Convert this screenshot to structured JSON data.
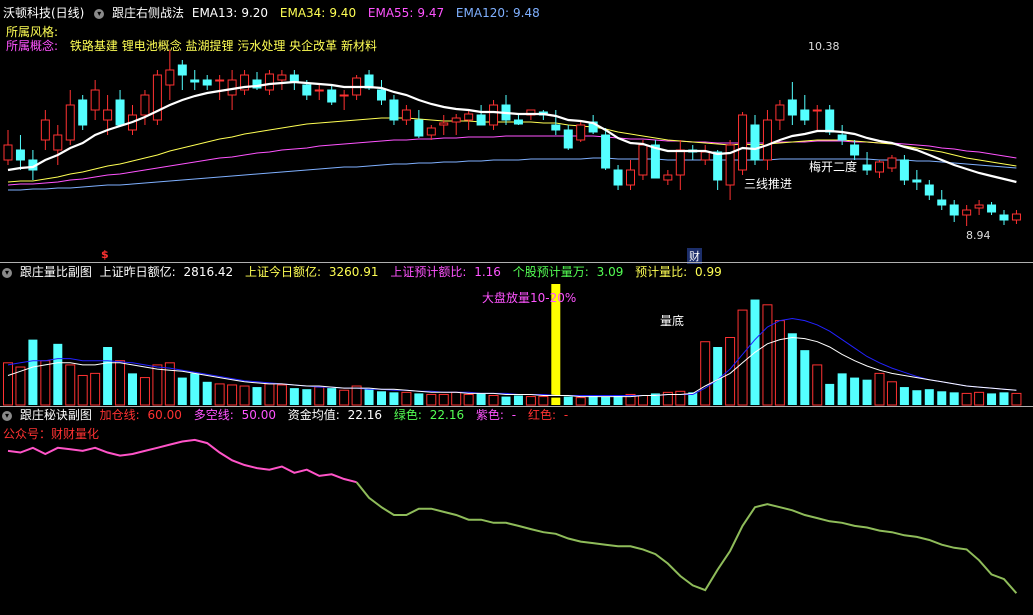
{
  "main_panel": {
    "stock_title": "沃顿科技(日线)",
    "indicator_name": "跟庄右侧战法",
    "ema13": {
      "label": "EMA13:",
      "value": "9.20"
    },
    "ema34": {
      "label": "EMA34:",
      "value": "9.40"
    },
    "ema55": {
      "label": "EMA55:",
      "value": "9.47"
    },
    "ema120": {
      "label": "EMA120:",
      "value": "9.48"
    },
    "style_label": "所属风格:",
    "concept_label": "所属概念:",
    "concepts": "铁路基建 锂电池概念 盐湖提锂 污水处理 央企改革 新材料",
    "high_label": "10.38",
    "low_label": "8.94",
    "annotation_push": "三线推进",
    "annotation_plum": "梅开二度",
    "marker_dollar": "$",
    "marker_cai": "财"
  },
  "volume_panel": {
    "name": "跟庄量比副图",
    "sh_yesterday": {
      "label": "上证昨日额亿:",
      "value": "2816.42"
    },
    "sh_today": {
      "label": "上证今日额亿:",
      "value": "3260.91"
    },
    "sh_forecast_ratio": {
      "label": "上证预计额比:",
      "value": "1.16"
    },
    "stock_forecast_vol": {
      "label": "个股预计量万:",
      "value": "3.09"
    },
    "forecast_ratio": {
      "label": "预计量比:",
      "value": "0.99"
    },
    "annotation_market": "大盘放量10-20%",
    "annotation_bottom": "量底"
  },
  "secret_panel": {
    "name": "跟庄秘诀副图",
    "add_line": {
      "label": "加仓线:",
      "value": "60.00"
    },
    "short_line": {
      "label": "多空线:",
      "value": "50.00"
    },
    "fund_avg": {
      "label": "资金均值:",
      "value": "22.16"
    },
    "green": {
      "label": "绿色:",
      "value": "22.16"
    },
    "purple": {
      "label": "紫色:",
      "value": "-"
    },
    "red": {
      "label": "红色:",
      "value": "-"
    },
    "public_account": "公众号：财财量化"
  },
  "colors": {
    "up": "#ff3232",
    "down": "#54ffff",
    "ema13": "#ffffff",
    "ema34": "#ffff54",
    "ema55": "#ff54ff",
    "ema120": "#7fb0ff",
    "vol_ma1": "#ffffff",
    "vol_ma2": "#2222ff",
    "yellow_bar": "#ffff00",
    "line_pink": "#ff54c8",
    "line_green": "#8fbc5a"
  },
  "chart_data": [
    {
      "type": "candlestick",
      "name": "price",
      "candles": [
        [
          9.6,
          9.9,
          9.55,
          9.75
        ],
        [
          9.7,
          9.85,
          9.5,
          9.6
        ],
        [
          9.6,
          9.7,
          9.4,
          9.5
        ],
        [
          9.8,
          10.1,
          9.7,
          10.0
        ],
        [
          9.7,
          9.95,
          9.55,
          9.85
        ],
        [
          9.8,
          10.3,
          9.75,
          10.15
        ],
        [
          10.2,
          10.25,
          9.9,
          9.95
        ],
        [
          10.1,
          10.4,
          10.0,
          10.3
        ],
        [
          10.0,
          10.25,
          9.85,
          10.1
        ],
        [
          10.2,
          10.3,
          9.95,
          9.95
        ],
        [
          9.9,
          10.15,
          9.85,
          10.05
        ],
        [
          10.05,
          10.3,
          9.95,
          10.25
        ],
        [
          10.0,
          10.5,
          9.95,
          10.45
        ],
        [
          10.35,
          10.7,
          10.2,
          10.5
        ],
        [
          10.55,
          10.6,
          10.3,
          10.45
        ],
        [
          10.4,
          10.5,
          10.3,
          10.38
        ],
        [
          10.4,
          10.45,
          10.3,
          10.35
        ],
        [
          10.4,
          10.45,
          10.2,
          10.4
        ],
        [
          10.25,
          10.5,
          10.1,
          10.4
        ],
        [
          10.3,
          10.5,
          10.25,
          10.45
        ],
        [
          10.4,
          10.48,
          10.3,
          10.32
        ],
        [
          10.3,
          10.5,
          10.25,
          10.46
        ],
        [
          10.4,
          10.5,
          10.3,
          10.45
        ],
        [
          10.45,
          10.5,
          10.3,
          10.38
        ],
        [
          10.35,
          10.4,
          10.2,
          10.25
        ],
        [
          10.3,
          10.35,
          10.2,
          10.3
        ],
        [
          10.3,
          10.35,
          10.15,
          10.18
        ],
        [
          10.25,
          10.3,
          10.1,
          10.25
        ],
        [
          10.25,
          10.45,
          10.2,
          10.42
        ],
        [
          10.45,
          10.5,
          10.3,
          10.32
        ],
        [
          10.3,
          10.4,
          10.15,
          10.2
        ],
        [
          10.2,
          10.25,
          9.95,
          10.0
        ],
        [
          10.0,
          10.15,
          9.95,
          10.1
        ],
        [
          10.0,
          10.1,
          9.82,
          9.84
        ],
        [
          9.85,
          9.95,
          9.8,
          9.92
        ],
        [
          9.95,
          10.05,
          9.85,
          9.97
        ],
        [
          9.98,
          10.06,
          9.85,
          10.02
        ],
        [
          10.0,
          10.1,
          9.9,
          10.06
        ],
        [
          10.05,
          10.15,
          9.95,
          9.95
        ],
        [
          9.95,
          10.2,
          9.9,
          10.15
        ],
        [
          10.15,
          10.25,
          9.95,
          10.0
        ],
        [
          10.0,
          10.05,
          9.95,
          9.96
        ],
        [
          10.05,
          10.1,
          10.0,
          10.1
        ],
        [
          10.08,
          10.1,
          10.0,
          10.05
        ],
        [
          9.95,
          10.1,
          9.85,
          9.9
        ],
        [
          9.9,
          9.95,
          9.7,
          9.72
        ],
        [
          9.8,
          10.0,
          9.78,
          9.95
        ],
        [
          9.98,
          10.05,
          9.86,
          9.88
        ],
        [
          9.85,
          9.92,
          9.5,
          9.52
        ],
        [
          9.5,
          9.55,
          9.3,
          9.35
        ],
        [
          9.35,
          9.6,
          9.3,
          9.5
        ],
        [
          9.45,
          9.8,
          9.4,
          9.75
        ],
        [
          9.75,
          9.8,
          9.42,
          9.42
        ],
        [
          9.4,
          9.5,
          9.35,
          9.45
        ],
        [
          9.45,
          9.8,
          9.3,
          9.7
        ],
        [
          9.7,
          9.75,
          9.6,
          9.68
        ],
        [
          9.6,
          9.75,
          9.55,
          9.68
        ],
        [
          9.68,
          9.7,
          9.3,
          9.4
        ],
        [
          9.35,
          9.8,
          9.2,
          9.75
        ],
        [
          9.5,
          10.08,
          9.45,
          10.05
        ],
        [
          9.95,
          10.05,
          9.55,
          9.6
        ],
        [
          9.6,
          10.1,
          9.5,
          10.0
        ],
        [
          10.0,
          10.2,
          9.9,
          10.15
        ],
        [
          10.2,
          10.38,
          9.95,
          10.05
        ],
        [
          10.1,
          10.25,
          9.95,
          10.0
        ],
        [
          10.1,
          10.15,
          9.9,
          10.1
        ],
        [
          10.1,
          10.15,
          9.85,
          9.88
        ],
        [
          9.85,
          9.95,
          9.75,
          9.8
        ],
        [
          9.75,
          9.8,
          9.6,
          9.65
        ],
        [
          9.55,
          9.68,
          9.45,
          9.5
        ],
        [
          9.48,
          9.6,
          9.42,
          9.58
        ],
        [
          9.52,
          9.65,
          9.48,
          9.62
        ],
        [
          9.6,
          9.65,
          9.35,
          9.4
        ],
        [
          9.4,
          9.5,
          9.3,
          9.38
        ],
        [
          9.35,
          9.4,
          9.2,
          9.25
        ],
        [
          9.2,
          9.3,
          9.1,
          9.15
        ],
        [
          9.15,
          9.2,
          8.98,
          9.05
        ],
        [
          9.05,
          9.15,
          8.94,
          9.1
        ],
        [
          9.12,
          9.2,
          9.05,
          9.15
        ],
        [
          9.15,
          9.18,
          9.05,
          9.08
        ],
        [
          9.05,
          9.1,
          8.95,
          9.0
        ],
        [
          9.0,
          9.1,
          8.96,
          9.06
        ]
      ],
      "ema13": [
        9.5,
        9.52,
        9.53,
        9.6,
        9.65,
        9.72,
        9.77,
        9.85,
        9.9,
        9.94,
        9.98,
        10.03,
        10.09,
        10.15,
        10.2,
        10.24,
        10.27,
        10.29,
        10.31,
        10.33,
        10.34,
        10.36,
        10.37,
        10.38,
        10.37,
        10.36,
        10.35,
        10.33,
        10.33,
        10.33,
        10.32,
        10.28,
        10.25,
        10.2,
        10.16,
        10.13,
        10.11,
        10.1,
        10.08,
        10.08,
        10.07,
        10.06,
        10.06,
        10.06,
        10.04,
        10.0,
        9.99,
        9.97,
        9.9,
        9.82,
        9.77,
        9.76,
        9.72,
        9.69,
        9.69,
        9.69,
        9.69,
        9.66,
        9.67,
        9.72,
        9.71,
        9.75,
        9.8,
        9.84,
        9.86,
        9.89,
        9.89,
        9.88,
        9.86,
        9.82,
        9.79,
        9.77,
        9.73,
        9.7,
        9.65,
        9.6,
        9.55,
        9.51,
        9.47,
        9.44,
        9.41,
        9.38
      ],
      "ema34": [
        9.38,
        9.39,
        9.39,
        9.41,
        9.43,
        9.46,
        9.48,
        9.51,
        9.54,
        9.56,
        9.59,
        9.62,
        9.65,
        9.69,
        9.72,
        9.75,
        9.78,
        9.81,
        9.83,
        9.86,
        9.88,
        9.9,
        9.92,
        9.94,
        9.96,
        9.97,
        9.98,
        9.99,
        10.0,
        10.01,
        10.02,
        10.02,
        10.02,
        10.01,
        10.0,
        9.99,
        9.99,
        9.99,
        9.98,
        9.98,
        9.98,
        9.98,
        9.98,
        9.97,
        9.97,
        9.95,
        9.94,
        9.93,
        9.91,
        9.88,
        9.86,
        9.84,
        9.82,
        9.8,
        9.79,
        9.78,
        9.77,
        9.76,
        9.75,
        9.76,
        9.75,
        9.76,
        9.77,
        9.78,
        9.79,
        9.8,
        9.8,
        9.8,
        9.79,
        9.78,
        9.77,
        9.76,
        9.74,
        9.72,
        9.7,
        9.68,
        9.65,
        9.62,
        9.6,
        9.58,
        9.56,
        9.54
      ],
      "ema55": [
        9.35,
        9.36,
        9.36,
        9.37,
        9.38,
        9.4,
        9.41,
        9.43,
        9.45,
        9.46,
        9.48,
        9.5,
        9.52,
        9.54,
        9.56,
        9.58,
        9.6,
        9.62,
        9.63,
        9.65,
        9.67,
        9.68,
        9.7,
        9.71,
        9.72,
        9.74,
        9.75,
        9.76,
        9.77,
        9.78,
        9.79,
        9.8,
        9.8,
        9.81,
        9.81,
        9.82,
        9.82,
        9.83,
        9.83,
        9.83,
        9.84,
        9.84,
        9.84,
        9.84,
        9.84,
        9.84,
        9.84,
        9.84,
        9.83,
        9.82,
        9.81,
        9.81,
        9.8,
        9.79,
        9.79,
        9.78,
        9.78,
        9.77,
        9.77,
        9.77,
        9.77,
        9.77,
        9.78,
        9.78,
        9.78,
        9.79,
        9.79,
        9.79,
        9.78,
        9.78,
        9.77,
        9.77,
        9.76,
        9.75,
        9.74,
        9.72,
        9.71,
        9.69,
        9.68,
        9.66,
        9.64,
        9.62
      ],
      "ema120": [
        9.3,
        9.3,
        9.31,
        9.31,
        9.32,
        9.32,
        9.33,
        9.34,
        9.35,
        9.35,
        9.36,
        9.37,
        9.38,
        9.39,
        9.4,
        9.41,
        9.42,
        9.43,
        9.44,
        9.45,
        9.46,
        9.47,
        9.48,
        9.49,
        9.5,
        9.51,
        9.52,
        9.53,
        9.53,
        9.54,
        9.55,
        9.56,
        9.56,
        9.57,
        9.57,
        9.58,
        9.58,
        9.59,
        9.59,
        9.6,
        9.6,
        9.6,
        9.61,
        9.61,
        9.61,
        9.61,
        9.61,
        9.62,
        9.62,
        9.61,
        9.61,
        9.61,
        9.61,
        9.6,
        9.6,
        9.6,
        9.6,
        9.6,
        9.6,
        9.6,
        9.6,
        9.6,
        9.61,
        9.61,
        9.61,
        9.61,
        9.61,
        9.61,
        9.61,
        9.61,
        9.6,
        9.6,
        9.6,
        9.59,
        9.59,
        9.58,
        9.57,
        9.56,
        9.55,
        9.54,
        9.53,
        9.52
      ],
      "ylim": [
        8.8,
        10.8
      ]
    },
    {
      "type": "bar",
      "name": "volume",
      "values": [
        40,
        36,
        62,
        42,
        58,
        38,
        28,
        30,
        55,
        42,
        30,
        26,
        38,
        40,
        26,
        30,
        22,
        20,
        19,
        18,
        17,
        20,
        19,
        16,
        15,
        17,
        16,
        14,
        18,
        15,
        13,
        12,
        12,
        11,
        10,
        10,
        12,
        10,
        11,
        9,
        8,
        9,
        8,
        8,
        7,
        8,
        7,
        9,
        8,
        9,
        10,
        9,
        11,
        12,
        13,
        12,
        60,
        55,
        64,
        90,
        100,
        95,
        80,
        68,
        52,
        38,
        20,
        30,
        26,
        24,
        30,
        22,
        17,
        14,
        15,
        13,
        12,
        11,
        12,
        11,
        12,
        11
      ],
      "up": [
        1,
        1,
        0,
        1,
        0,
        1,
        1,
        1,
        0,
        1,
        0,
        1,
        1,
        1,
        0,
        0,
        0,
        1,
        1,
        1,
        0,
        1,
        1,
        0,
        0,
        1,
        0,
        1,
        1,
        0,
        0,
        0,
        1,
        0,
        1,
        1,
        1,
        1,
        0,
        1,
        0,
        0,
        1,
        1,
        0,
        0,
        1,
        0,
        0,
        0,
        1,
        1,
        0,
        1,
        1,
        0,
        1,
        0,
        1,
        1,
        0,
        1,
        1,
        0,
        0,
        1,
        0,
        0,
        0,
        0,
        1,
        1,
        0,
        0,
        0,
        0,
        0,
        1,
        1,
        0,
        0,
        1
      ],
      "highlight_index": 44,
      "ma1": [
        28,
        32,
        36,
        38,
        40,
        40,
        38,
        38,
        40,
        40,
        38,
        36,
        34,
        33,
        32,
        30,
        28,
        26,
        24,
        22,
        21,
        20,
        20,
        19,
        18,
        18,
        17,
        16,
        16,
        16,
        15,
        15,
        14,
        13,
        12,
        12,
        12,
        11,
        11,
        11,
        10,
        10,
        10,
        9,
        9,
        9,
        8,
        8,
        8,
        8,
        8,
        9,
        9,
        10,
        10,
        11,
        18,
        24,
        30,
        40,
        50,
        58,
        62,
        64,
        63,
        60,
        55,
        48,
        42,
        37,
        33,
        30,
        28,
        26,
        24,
        22,
        20,
        18,
        17,
        16,
        15,
        14
      ],
      "ma2": [
        38,
        40,
        42,
        42,
        44,
        44,
        42,
        42,
        42,
        41,
        40,
        38,
        36,
        35,
        33,
        31,
        29,
        27,
        25,
        23,
        22,
        21,
        20,
        19,
        18,
        17,
        17,
        16,
        16,
        15,
        15,
        14,
        14,
        13,
        13,
        12,
        12,
        12,
        11,
        11,
        11,
        10,
        10,
        10,
        9,
        9,
        9,
        9,
        9,
        9,
        9,
        9,
        9,
        10,
        10,
        10,
        16,
        24,
        34,
        48,
        62,
        74,
        80,
        82,
        80,
        76,
        70,
        62,
        54,
        46,
        40,
        35,
        31,
        27,
        24,
        22,
        20,
        18,
        17,
        16,
        15,
        14
      ],
      "ylim": [
        0,
        110
      ]
    },
    {
      "type": "line",
      "name": "fund_avg",
      "values": [
        86,
        85,
        88,
        84,
        88,
        87,
        86,
        88,
        85,
        83,
        84,
        86,
        88,
        90,
        92,
        93,
        91,
        85,
        80,
        77,
        75,
        74,
        76,
        72,
        74,
        70,
        71,
        68,
        66,
        56,
        50,
        45,
        45,
        49,
        49,
        47,
        45,
        42,
        42,
        40,
        40,
        38,
        36,
        34,
        33,
        30,
        28,
        27,
        26,
        25,
        25,
        23,
        20,
        14,
        6,
        0,
        -3,
        10,
        22,
        38,
        50,
        52,
        50,
        48,
        45,
        43,
        41,
        40,
        38,
        37,
        35,
        34,
        32,
        31,
        29,
        26,
        24,
        23,
        16,
        7,
        4,
        -5
      ],
      "ylim": [
        -10,
        100
      ]
    }
  ]
}
